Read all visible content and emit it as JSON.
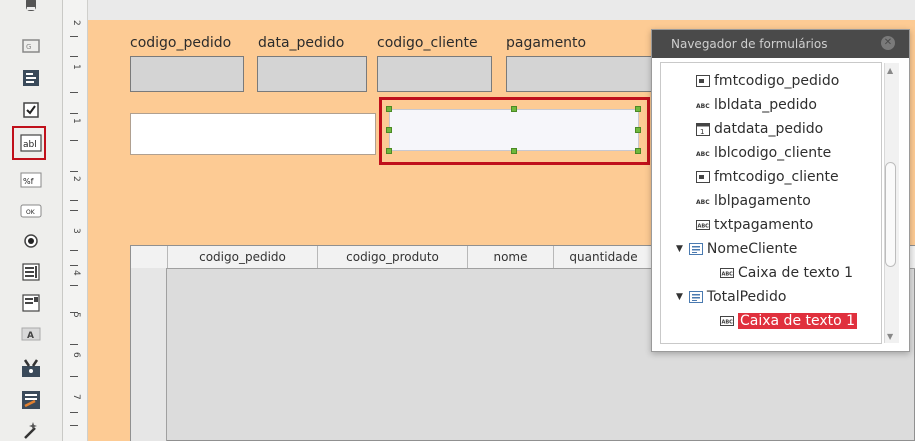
{
  "form": {
    "labels": [
      "codigo_pedido",
      "data_pedido",
      "codigo_cliente",
      "pagamento"
    ]
  },
  "grid": {
    "columns": [
      "codigo_pedido",
      "codigo_produto",
      "nome",
      "quantidade"
    ]
  },
  "navigator": {
    "title": "Navegador de formulários",
    "items": [
      {
        "label": "fmtcodigo_pedido",
        "icon": "formatted-field-icon",
        "level": 1
      },
      {
        "label": "lbldata_pedido",
        "icon": "label-icon",
        "level": 1
      },
      {
        "label": "datdata_pedido",
        "icon": "date-field-icon",
        "level": 1
      },
      {
        "label": "lblcodigo_cliente",
        "icon": "label-icon",
        "level": 1
      },
      {
        "label": "fmtcodigo_cliente",
        "icon": "formatted-field-icon",
        "level": 1
      },
      {
        "label": "lblpagamento",
        "icon": "label-icon",
        "level": 1
      },
      {
        "label": "txtpagamento",
        "icon": "text-box-icon",
        "level": 1
      },
      {
        "label": "NomeCliente",
        "icon": "form-icon",
        "level": 0
      },
      {
        "label": "Caixa de texto 1",
        "icon": "text-box-icon",
        "level": 1
      },
      {
        "label": "TotalPedido",
        "icon": "form-icon",
        "level": 0
      },
      {
        "label": "Caixa de texto 1",
        "icon": "text-box-icon",
        "level": 1
      }
    ]
  },
  "ruler": {
    "numbers": [
      "2",
      "1",
      "1",
      "2",
      "3",
      "4",
      "5",
      "6",
      "7"
    ]
  },
  "colors": {
    "form_background": "#fdcb94",
    "selection": "#c0101b",
    "handle": "#6fb83c",
    "nav_selected": "#e0303d"
  }
}
